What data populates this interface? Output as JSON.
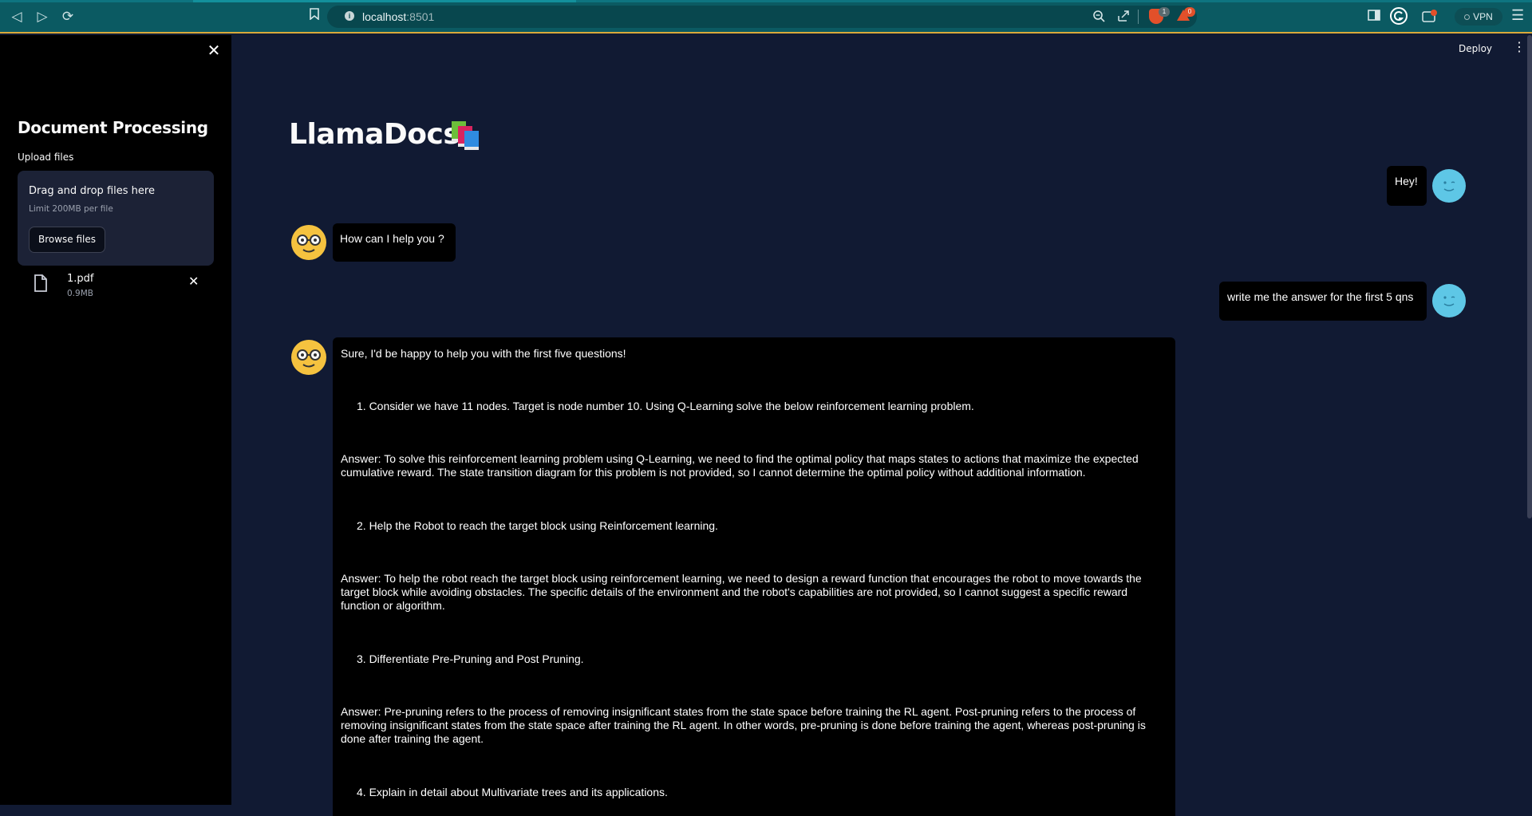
{
  "browser": {
    "url_host": "localhost",
    "url_port": ":8501",
    "vpn_label": "VPN",
    "brave_badge": "1",
    "rewards_badge": "0"
  },
  "sidebar": {
    "title": "Document Processing",
    "upload_label": "Upload files",
    "dropzone_title": "Drag and drop files here",
    "dropzone_limit": "Limit 200MB per file",
    "browse_button": "Browse files",
    "file": {
      "name": "1.pdf",
      "size": "0.9MB"
    }
  },
  "header": {
    "deploy_label": "Deploy"
  },
  "app": {
    "title": "LlamaDocs"
  },
  "chat": {
    "user_1": "Hey!",
    "bot_1": "How can I help you ?",
    "user_2": "write me the answer for the first 5 qns",
    "bot_2": {
      "intro": "Sure, I'd be happy to help you with the first five questions!",
      "q1": "1. Consider we have 11 nodes. Target is node number 10. Using Q-Learning solve the below reinforcement learning problem.",
      "a1": "Answer: To solve this reinforcement learning problem using Q-Learning, we need to find the optimal policy that maps states to actions that maximize the expected cumulative reward. The state transition diagram for this problem is not provided, so I cannot determine the optimal policy without additional information.",
      "q2": "2. Help the Robot to reach the target block using Reinforcement learning.",
      "a2": "Answer: To help the robot reach the target block using reinforcement learning, we need to design a reward function that encourages the robot to move towards the target block while avoiding obstacles. The specific details of the environment and the robot's capabilities are not provided, so I cannot suggest a specific reward function or algorithm.",
      "q3": "3. Differentiate Pre-Pruning and Post Pruning.",
      "a3": "Answer: Pre-pruning refers to the process of removing insignificant states from the state space before training the RL agent. Post-pruning refers to the process of removing insignificant states from the state space after training the RL agent. In other words, pre-pruning is done before training the agent, whereas post-pruning is done after training the agent.",
      "q4": "4. Explain in detail about Multivariate trees and its applications."
    }
  }
}
